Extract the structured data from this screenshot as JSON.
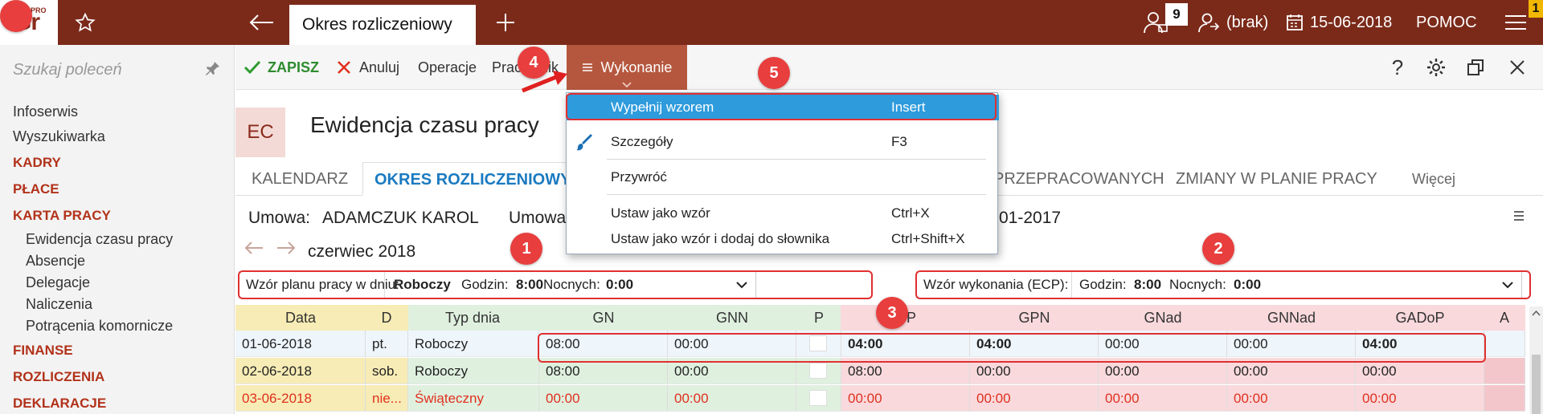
{
  "app": {
    "logo": "Gr",
    "logo_badge": "PRO"
  },
  "header": {
    "active_tab": "Okres rozliczeniowy",
    "notifications_count": "9",
    "user": "(brak)",
    "date": "15-06-2018",
    "help": "POMOC",
    "corner_badge": "1"
  },
  "sidebar": {
    "search_placeholder": "Szukaj poleceń",
    "items": [
      "Infoserwis",
      "Wyszukiwarka"
    ],
    "sections": [
      "KADRY",
      "PŁACE",
      "KARTA PRACY"
    ],
    "karta_items": [
      "Ewidencja czasu pracy",
      "Absencje",
      "Delegacje",
      "Naliczenia",
      "Potrącenia komornicze"
    ],
    "sections2": [
      "FINANSE",
      "ROZLICZENIA",
      "DEKLARACJE"
    ]
  },
  "toolbar": {
    "save": "ZAPISZ",
    "cancel": "Anuluj",
    "operations": "Operacje",
    "worker": "Pracownik",
    "execution": "Wykonanie"
  },
  "page": {
    "badge": "EC",
    "title": "Ewidencja czasu pracy"
  },
  "tabs": [
    "KALENDARZ",
    "OKRES ROZLICZENIOWY",
    "PRZEPRACOWANYCH",
    "ZMIANY W PLANIE PRACY",
    "Więcej"
  ],
  "contract": {
    "label": "Umowa:",
    "value": "ADAMCZUK KAROL",
    "label2": "Umowa",
    "date": "01-2017"
  },
  "month": "czerwiec 2018",
  "plan_pattern": {
    "label": "Wzór planu pracy w dniu:",
    "type": "Roboczy",
    "hours_label": "Godzin:",
    "hours": "8:00",
    "night_label": "Nocnych:",
    "night": "0:00"
  },
  "exec_pattern": {
    "label": "Wzór wykonania (ECP):",
    "hours_label": "Godzin:",
    "hours": "8:00",
    "night_label": "Nocnych:",
    "night": "0:00"
  },
  "table": {
    "headers": [
      "Data",
      "D",
      "Typ dnia",
      "GN",
      "GNN",
      "P",
      "GP",
      "GPN",
      "GNad",
      "GNNad",
      "GADoP",
      "A"
    ],
    "rows": [
      [
        "01-06-2018",
        "pt.",
        "Roboczy",
        "08:00",
        "00:00",
        "",
        "04:00",
        "04:00",
        "00:00",
        "00:00",
        "04:00",
        ""
      ],
      [
        "02-06-2018",
        "sob.",
        "Roboczy",
        "08:00",
        "00:00",
        "",
        "08:00",
        "00:00",
        "00:00",
        "00:00",
        "00:00",
        ""
      ],
      [
        "03-06-2018",
        "nie...",
        "Świąteczny",
        "00:00",
        "00:00",
        "",
        "00:00",
        "00:00",
        "00:00",
        "00:00",
        "00:00",
        ""
      ]
    ]
  },
  "dropdown": {
    "items": [
      {
        "label": "Wypełnij wzorem",
        "shortcut": "Insert"
      },
      {
        "label": "Szczegóły",
        "shortcut": "F3"
      },
      {
        "label": "Przywróć",
        "shortcut": ""
      },
      {
        "label": "Ustaw jako wzór",
        "shortcut": "Ctrl+X"
      },
      {
        "label": "Ustaw jako wzór i dodaj do słownika",
        "shortcut": "Ctrl+Shift+X"
      }
    ]
  },
  "annotations": [
    "1",
    "2",
    "3",
    "4",
    "5"
  ],
  "colors": {
    "brand": "#7b2a1a",
    "accent": "#b5573e",
    "section": "#b2321a",
    "tab_active": "#1a7ac0",
    "selection": "#2e9bdd",
    "holiday": "#e0301e",
    "annotation": "#e83e3e"
  }
}
